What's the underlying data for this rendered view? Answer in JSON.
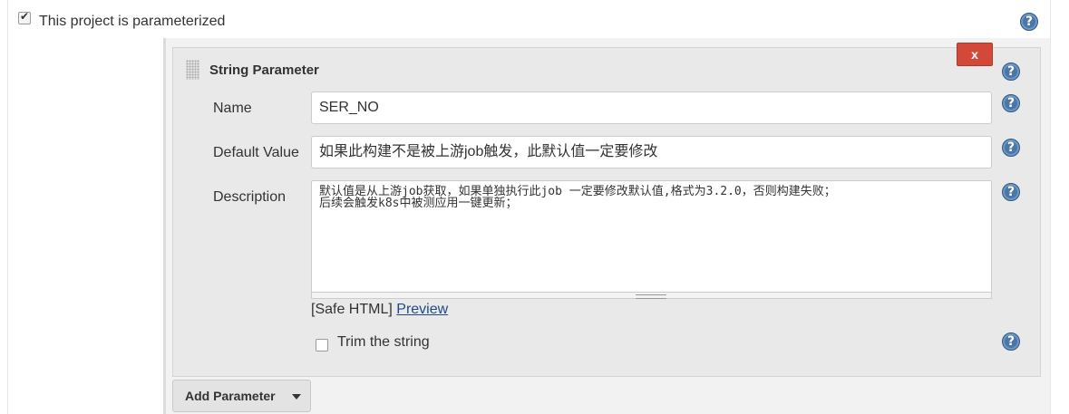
{
  "parameterized": {
    "label": "This project is parameterized",
    "checked": true
  },
  "parameter": {
    "title": "String Parameter",
    "delete_label": "x",
    "fields": {
      "name": {
        "label": "Name",
        "value": "SER_NO"
      },
      "default_value": {
        "label": "Default Value",
        "value": "如果此构建不是被上游job触发，此默认值一定要修改"
      },
      "description": {
        "label": "Description",
        "value": "默认值是从上游job获取，如果单独执行此job 一定要修改默认值,格式为3.2.0，否则构建失败；\n后续会触发k8s中被测应用一键更新；"
      }
    },
    "safe_html": "[Safe HTML]",
    "preview_link": "Preview",
    "trim": {
      "label": "Trim the string",
      "checked": false
    }
  },
  "add_parameter_label": "Add Parameter",
  "help_glyph": "?",
  "icons": [
    "help-icon",
    "caret-down-icon",
    "drag-handle-icon",
    "checkbox-icon"
  ],
  "colors": {
    "help_icon": "#4a76a8",
    "delete_button": "#d24939",
    "link": "#204a87"
  }
}
